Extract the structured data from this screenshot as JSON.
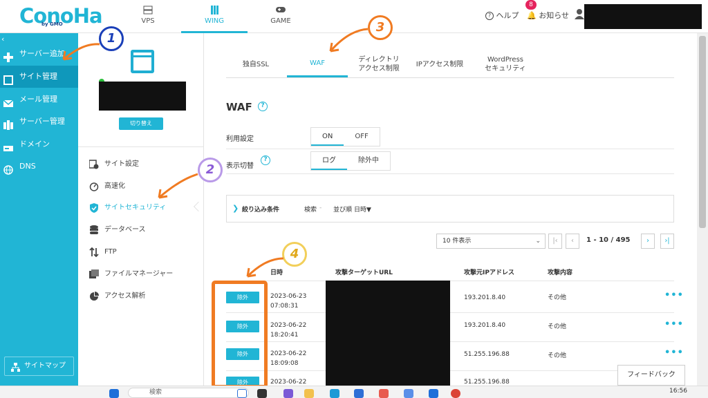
{
  "header": {
    "logo": "ConoHa",
    "logo_sub": "by GMO",
    "nav": [
      {
        "label": "VPS",
        "icon": "server-icon"
      },
      {
        "label": "WING",
        "icon": "wing-icon",
        "active": true
      },
      {
        "label": "GAME",
        "icon": "gamepad-icon"
      }
    ],
    "help_label": "ヘルプ",
    "notice_label": "お知らせ",
    "notice_count": "8",
    "accent_color": "#21b5d5"
  },
  "sidebar": {
    "items": [
      {
        "label": "サーバー追加",
        "icon": "plus-icon"
      },
      {
        "label": "サイト管理",
        "icon": "site-icon",
        "active": true
      },
      {
        "label": "メール管理",
        "icon": "mail-icon"
      },
      {
        "label": "サーバー管理",
        "icon": "server-manage-icon"
      },
      {
        "label": "ドメイン",
        "icon": "domain-icon"
      },
      {
        "label": "DNS",
        "icon": "globe-icon"
      }
    ],
    "sitemap_label": "サイトマップ"
  },
  "subnav": {
    "switch_label": "切り替え",
    "items": [
      {
        "label": "サイト設定",
        "icon": "site-settings-icon"
      },
      {
        "label": "高速化",
        "icon": "speed-icon"
      },
      {
        "label": "サイトセキュリティ",
        "icon": "shield-icon",
        "active": true
      },
      {
        "label": "データベース",
        "icon": "database-icon"
      },
      {
        "label": "FTP",
        "icon": "ftp-icon"
      },
      {
        "label": "ファイルマネージャー",
        "icon": "file-manager-icon"
      },
      {
        "label": "アクセス解析",
        "icon": "pie-chart-icon"
      }
    ]
  },
  "main": {
    "tabs": [
      {
        "label": "独自SSL"
      },
      {
        "label": "WAF",
        "active": true
      },
      {
        "label": "ディレクトリ\nアクセス制限"
      },
      {
        "label": "IPアクセス制限"
      },
      {
        "label": "WordPress\nセキュリティ"
      }
    ],
    "title": "WAF",
    "usage_label": "利用設定",
    "usage_options": [
      "ON",
      "OFF"
    ],
    "usage_selected": "ON",
    "display_label": "表示切替",
    "display_options": [
      "ログ",
      "除外中"
    ],
    "display_selected": "ログ",
    "filter": {
      "label": "絞り込み条件",
      "search": "検索",
      "sort": "並び順",
      "sort_value": "日時▼"
    },
    "per_page": "10 件表示",
    "pagination": {
      "from": "1",
      "to": "10",
      "total": "495"
    },
    "columns": [
      "日時",
      "攻撃ターゲットURL",
      "攻撃元IPアドレス",
      "攻撃内容"
    ],
    "rows": [
      {
        "button": "除外",
        "date": "2023-06-23",
        "time": "07:08:31",
        "ip": "193.201.8.40",
        "type": "その他"
      },
      {
        "button": "除外",
        "date": "2023-06-22",
        "time": "18:20:41",
        "ip": "193.201.8.40",
        "type": "その他"
      },
      {
        "button": "除外",
        "date": "2023-06-22",
        "time": "18:09:08",
        "ip": "51.255.196.88",
        "type": "その他"
      },
      {
        "button": "除外",
        "date": "2023-06-22",
        "time": "",
        "ip": "51.255.196.88",
        "type": "その他"
      }
    ],
    "feedback_label": "フィードバック"
  },
  "annotations": [
    "1",
    "2",
    "3",
    "4"
  ],
  "taskbar": {
    "search_placeholder": "検索",
    "clock": "16:56"
  }
}
